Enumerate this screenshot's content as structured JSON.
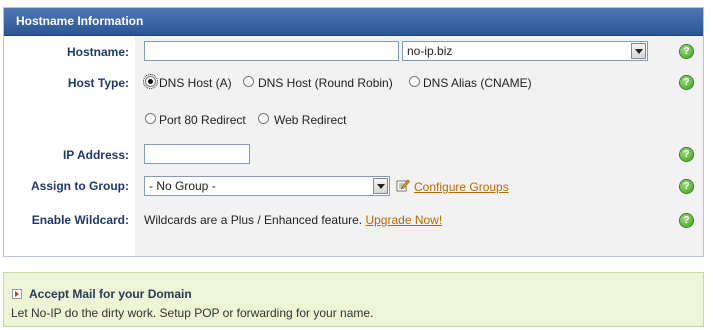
{
  "panel": {
    "title": "Hostname Information"
  },
  "fields": {
    "hostname": {
      "label": "Hostname:",
      "value": "",
      "domain_selected": "no-ip.biz"
    },
    "host_type": {
      "label": "Host Type:",
      "options": [
        {
          "label": "DNS Host (A)",
          "checked": true
        },
        {
          "label": "DNS Host (Round Robin)",
          "checked": false
        },
        {
          "label": "DNS Alias (CNAME)",
          "checked": false
        },
        {
          "label": "Port 80 Redirect",
          "checked": false
        },
        {
          "label": "Web Redirect",
          "checked": false
        }
      ]
    },
    "ip_address": {
      "label": "IP Address:",
      "value": ""
    },
    "group": {
      "label": "Assign to Group:",
      "selected": "- No Group -",
      "configure_link": "Configure Groups"
    },
    "wildcard": {
      "label": "Enable Wildcard:",
      "text": "Wildcards are a Plus / Enhanced feature.",
      "upgrade_link": "Upgrade Now!"
    }
  },
  "help_icon": {
    "glyph": "?"
  },
  "promo": {
    "title": "Accept Mail for your Domain",
    "text": "Let No-IP do the dirty work. Setup POP or forwarding for your name."
  },
  "colors": {
    "header_bg": "#2b5594",
    "label_text": "#1f3a66",
    "link": "#b86a00",
    "promo_bg": "#edf5d6",
    "help_icon": "#3c9a1e"
  }
}
